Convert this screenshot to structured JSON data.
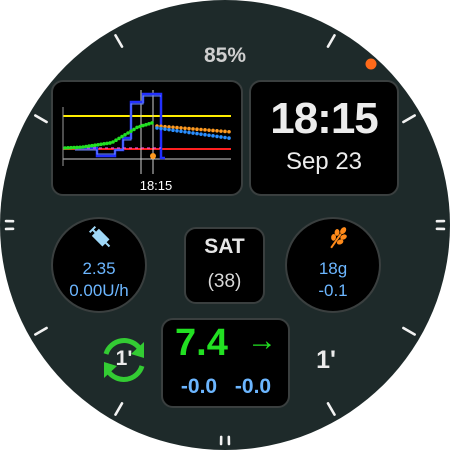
{
  "battery": "85%",
  "time": "18:15",
  "date": "Sep 23",
  "graph": {
    "time_label": "18:15"
  },
  "insulin": {
    "iob": "2.35",
    "basal_rate": "0.00U/h",
    "icon": "syringe-icon"
  },
  "day": {
    "name": "SAT",
    "number": "(38)"
  },
  "carbs": {
    "cob": "18g",
    "delta": "-0.1",
    "icon": "wheat-icon"
  },
  "glucose": {
    "value": "7.4",
    "trend_arrow": "→",
    "delta": "-0.0",
    "avg_delta": "-0.0"
  },
  "loop": {
    "minutes": "1'",
    "icon": "loop-refresh-icon"
  },
  "last_reading": {
    "age": "1'"
  },
  "colors": {
    "bezel": "#1e2a2a",
    "panel_border": "#3a3f3f",
    "accent_orange": "#ff6a1a",
    "glucose_green": "#22e022",
    "value_blue": "#6cb6ff",
    "loop_green": "#33cc33"
  }
}
